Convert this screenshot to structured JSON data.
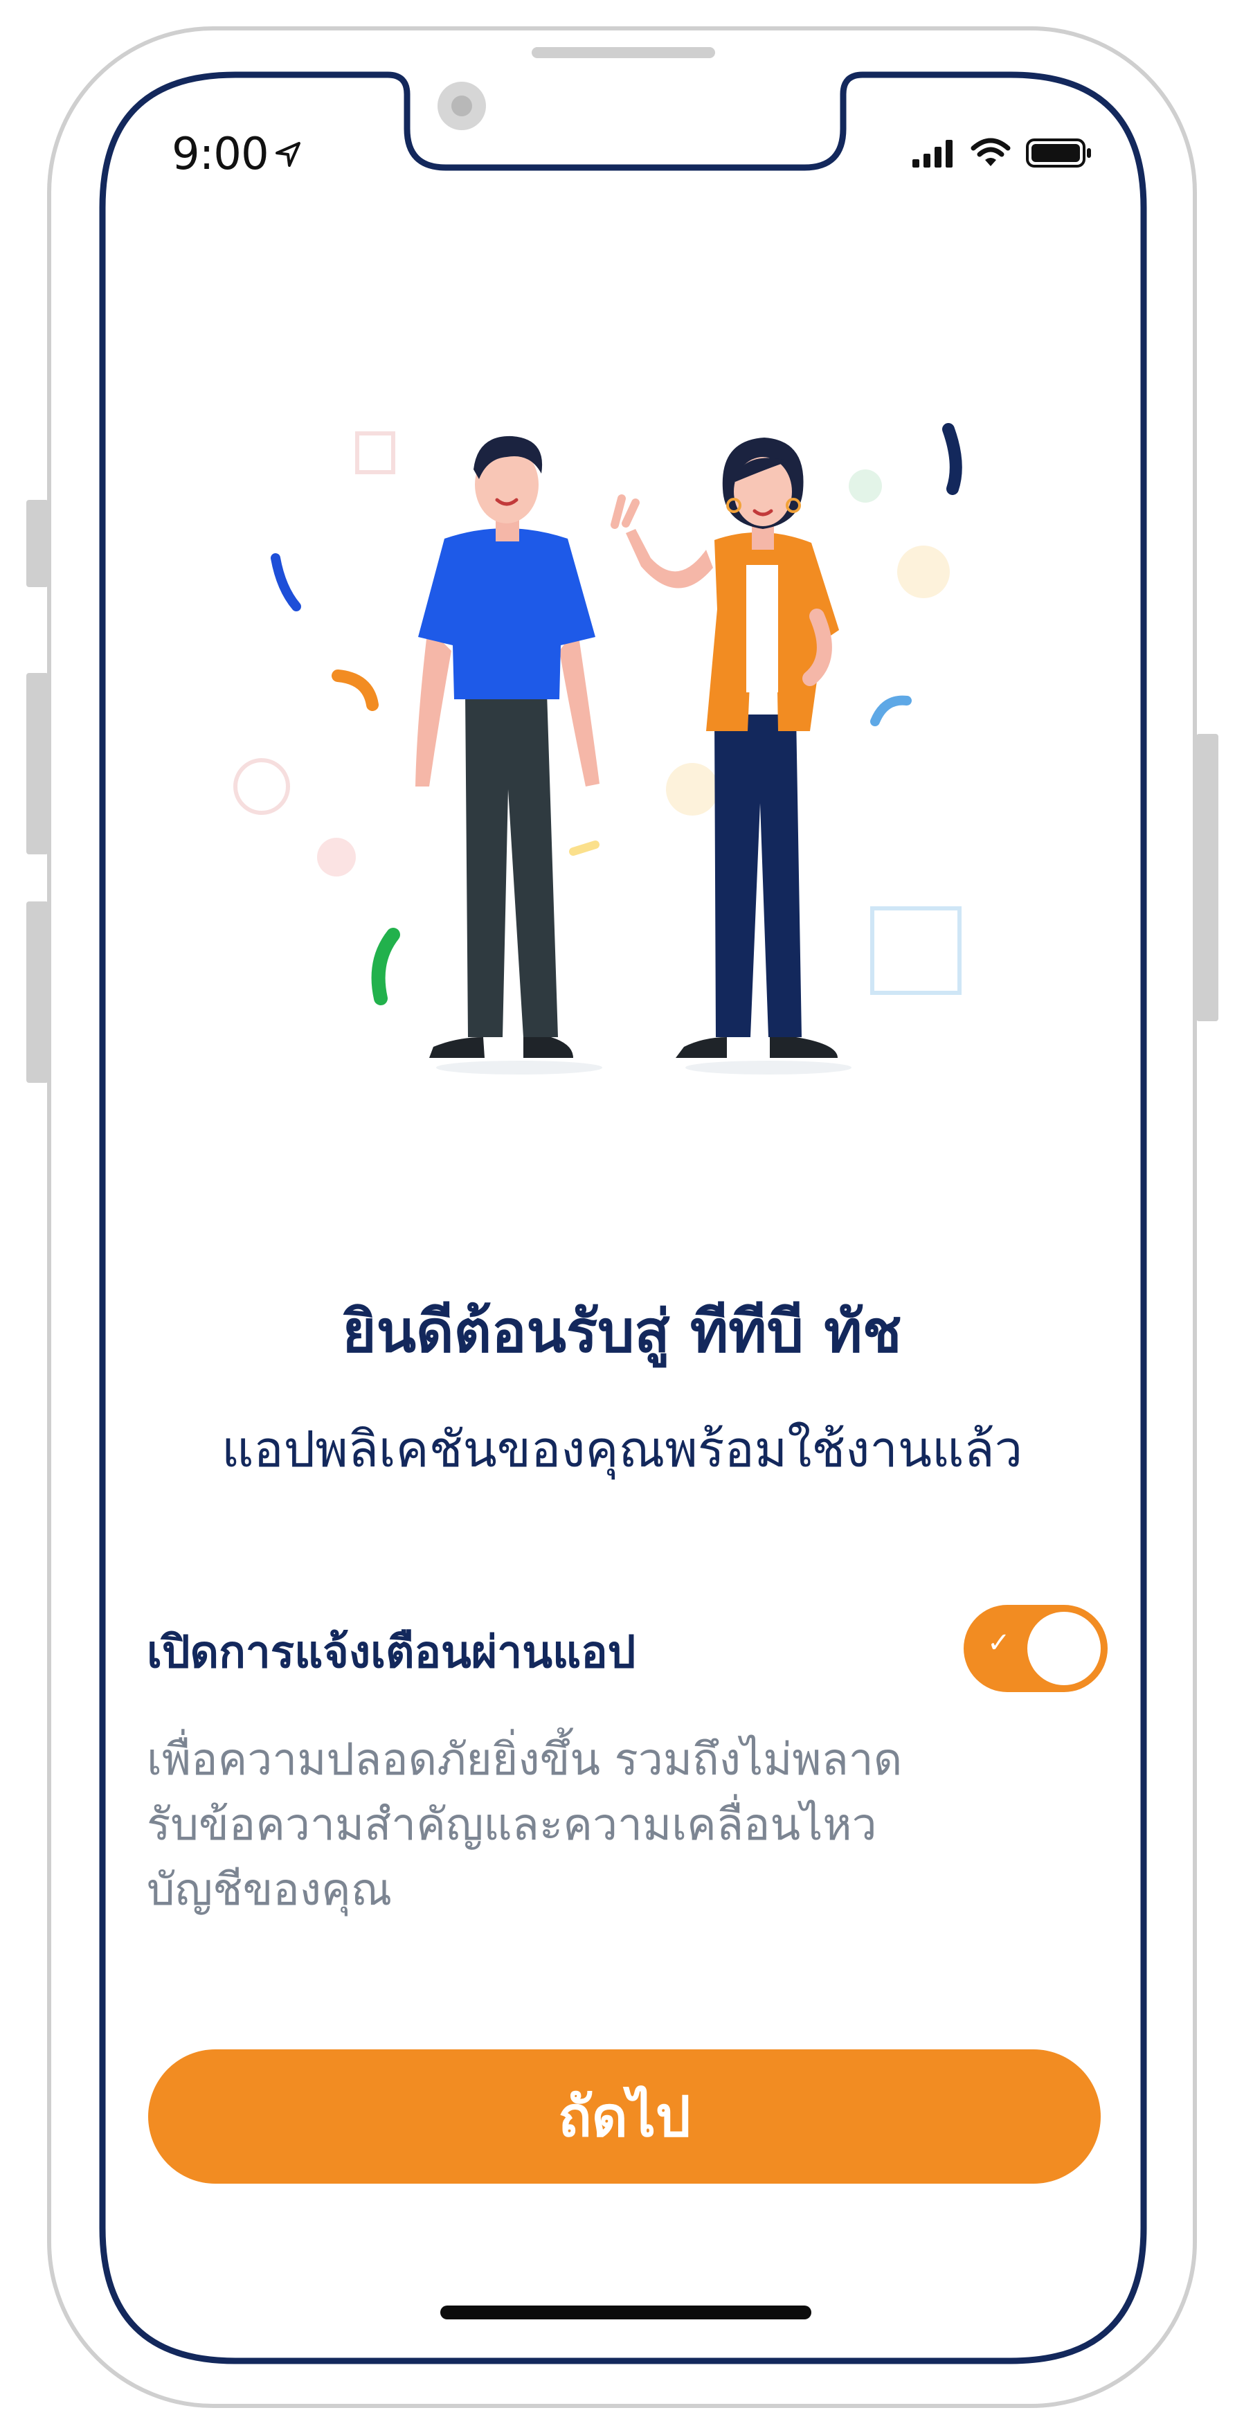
{
  "status_bar": {
    "time": "9:00"
  },
  "welcome": {
    "title": "ยินดีต้อนรับสู่ ทีทีบี ทัช",
    "subtitle": "แอปพลิเคชันของคุณพร้อมใช้งานแล้ว"
  },
  "notification": {
    "label": "เปิดการแจ้งเตือนผ่านแอป",
    "description_lines": [
      "เพื่อความปลอดภัยยิ่งขึ้น รวมถึงไม่พลาด",
      "รับข้อความสำคัญและความเคลื่อนไหว",
      "บัญชีของคุณ"
    ],
    "enabled": true
  },
  "next_button": {
    "label": "ถัดไป"
  },
  "colors": {
    "brand_navy": "#13285c",
    "accent_orange": "#f28c22",
    "muted_text": "#7c8592",
    "frame_gray": "#cfcfcf"
  },
  "icons": [
    "location-arrow-icon",
    "signal-icon",
    "wifi-icon",
    "battery-icon",
    "check-icon"
  ]
}
